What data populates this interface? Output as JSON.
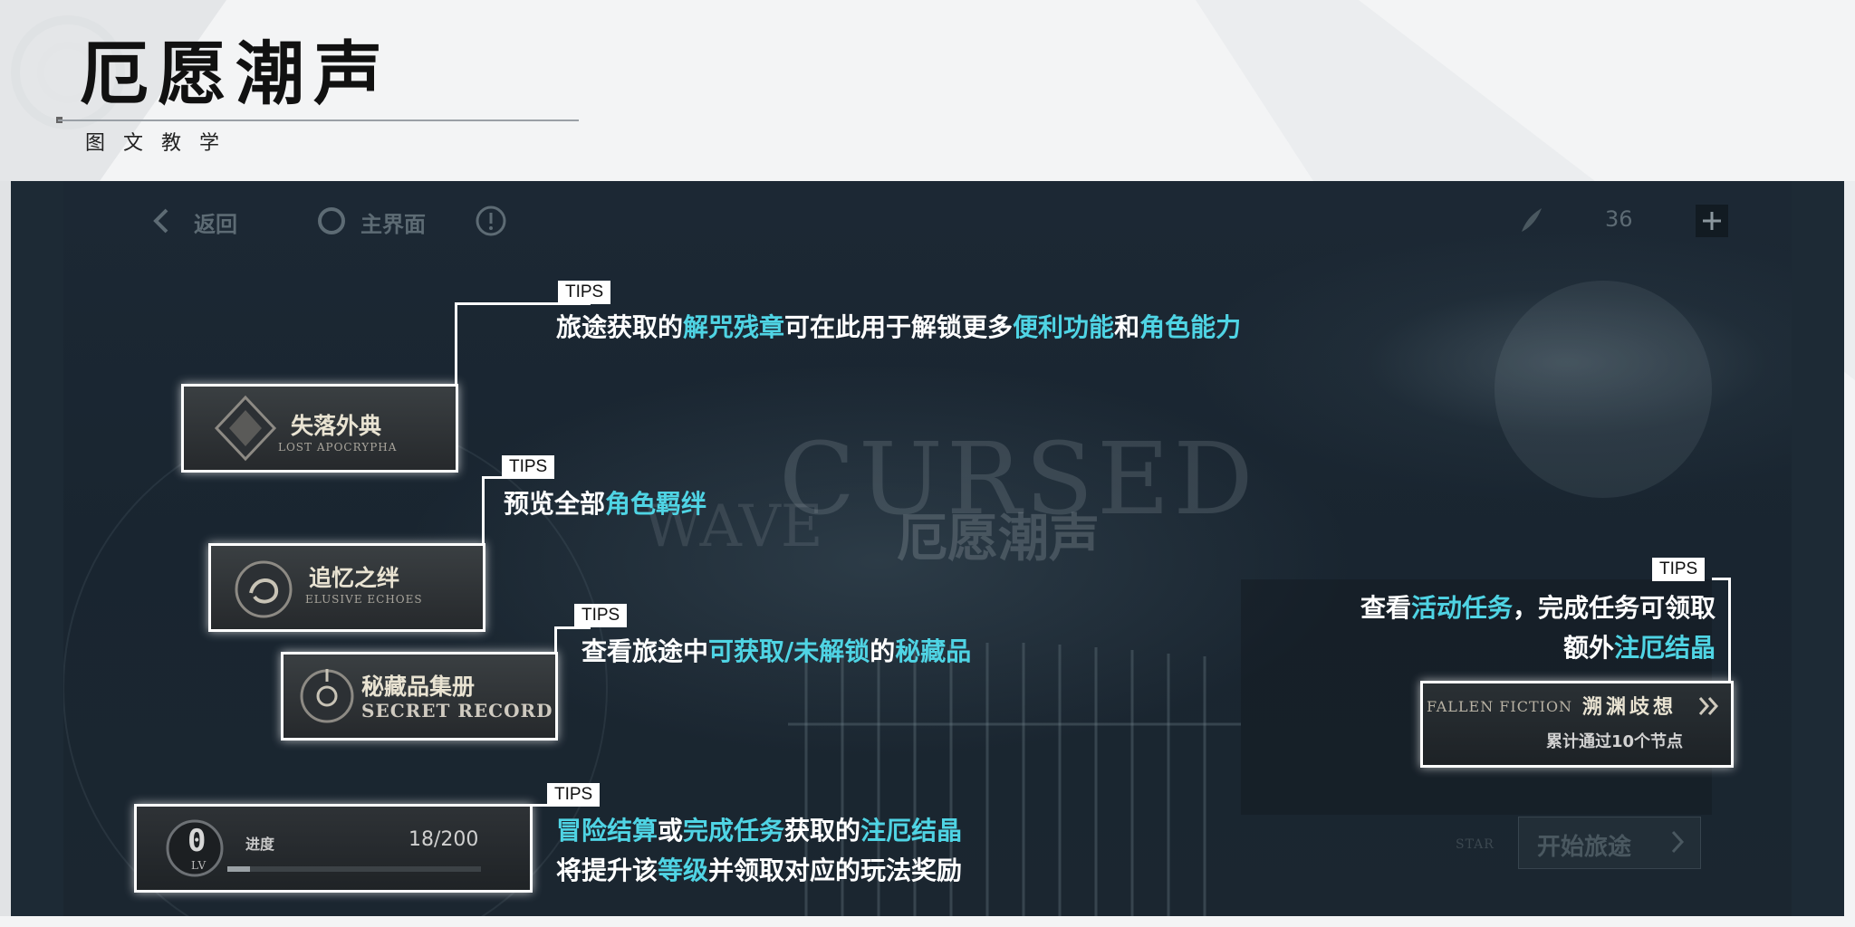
{
  "header": {
    "title": "厄愿潮声",
    "subtitle": "图文教学"
  },
  "topbar": {
    "back_label": "返回",
    "home_label": "主界面",
    "currency_value": "36"
  },
  "watermark": {
    "line1": "CURSED",
    "line2": "WAVE",
    "cn": "厄愿潮声"
  },
  "cards": {
    "lost_apocrypha": {
      "title": "失落外典",
      "subtitle": "LOST APOCRYPHA"
    },
    "elusive_echoes": {
      "title": "追忆之绊",
      "subtitle": "ELUSIVE ECHOES"
    },
    "secret_record": {
      "title": "秘藏品集册",
      "subtitle": "SECRET RECORD"
    },
    "level": {
      "level_value": "0",
      "level_label": "LV",
      "progress_label": "进度",
      "progress_value": "18/200",
      "progress_fraction": 0.09
    },
    "fallen_fiction": {
      "en_title": "FALLEN FICTION",
      "cn_title": "溯渊歧想",
      "desc": "累计通过10个节点"
    }
  },
  "tips_label": "TIPS",
  "tips": {
    "t1": {
      "p1": "旅途获取的",
      "h1": "解咒残章",
      "p2": "可在此用于解锁更多",
      "h2": "便利功能",
      "p3": "和",
      "h3": "角色能力"
    },
    "t2": {
      "p1": "预览全部",
      "h1": "角色羁绊"
    },
    "t3": {
      "p1": "查看旅途中",
      "h1": "可获取/未解锁",
      "p2": "的",
      "h2": "秘藏品"
    },
    "t4": {
      "p1": "查看",
      "h1": "活动任务",
      "p2": "，完成任务可领取",
      "p3": "额外",
      "h2": "注厄结晶"
    },
    "t5": {
      "h1": "冒险结算",
      "p1": "或",
      "h2": "完成任务",
      "p2": "获取的",
      "h3": "注厄结晶",
      "p3": "将提升该",
      "h4": "等级",
      "p4": "并领取对应的玩法奖励"
    }
  },
  "start_button": {
    "label": "开始旅途",
    "prefix": "STAR"
  },
  "colors": {
    "highlight": "#4fd4e4",
    "panel": "#1d2a35",
    "text": "#ffffff"
  }
}
